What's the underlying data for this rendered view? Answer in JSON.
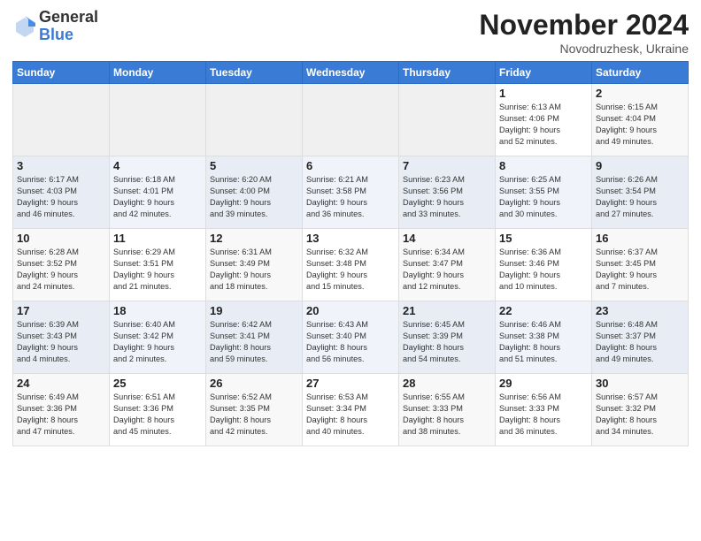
{
  "logo": {
    "general": "General",
    "blue": "Blue"
  },
  "title": "November 2024",
  "location": "Novodruzhesk, Ukraine",
  "days_of_week": [
    "Sunday",
    "Monday",
    "Tuesday",
    "Wednesday",
    "Thursday",
    "Friday",
    "Saturday"
  ],
  "weeks": [
    [
      {
        "day": "",
        "info": ""
      },
      {
        "day": "",
        "info": ""
      },
      {
        "day": "",
        "info": ""
      },
      {
        "day": "",
        "info": ""
      },
      {
        "day": "",
        "info": ""
      },
      {
        "day": "1",
        "info": "Sunrise: 6:13 AM\nSunset: 4:06 PM\nDaylight: 9 hours\nand 52 minutes."
      },
      {
        "day": "2",
        "info": "Sunrise: 6:15 AM\nSunset: 4:04 PM\nDaylight: 9 hours\nand 49 minutes."
      }
    ],
    [
      {
        "day": "3",
        "info": "Sunrise: 6:17 AM\nSunset: 4:03 PM\nDaylight: 9 hours\nand 46 minutes."
      },
      {
        "day": "4",
        "info": "Sunrise: 6:18 AM\nSunset: 4:01 PM\nDaylight: 9 hours\nand 42 minutes."
      },
      {
        "day": "5",
        "info": "Sunrise: 6:20 AM\nSunset: 4:00 PM\nDaylight: 9 hours\nand 39 minutes."
      },
      {
        "day": "6",
        "info": "Sunrise: 6:21 AM\nSunset: 3:58 PM\nDaylight: 9 hours\nand 36 minutes."
      },
      {
        "day": "7",
        "info": "Sunrise: 6:23 AM\nSunset: 3:56 PM\nDaylight: 9 hours\nand 33 minutes."
      },
      {
        "day": "8",
        "info": "Sunrise: 6:25 AM\nSunset: 3:55 PM\nDaylight: 9 hours\nand 30 minutes."
      },
      {
        "day": "9",
        "info": "Sunrise: 6:26 AM\nSunset: 3:54 PM\nDaylight: 9 hours\nand 27 minutes."
      }
    ],
    [
      {
        "day": "10",
        "info": "Sunrise: 6:28 AM\nSunset: 3:52 PM\nDaylight: 9 hours\nand 24 minutes."
      },
      {
        "day": "11",
        "info": "Sunrise: 6:29 AM\nSunset: 3:51 PM\nDaylight: 9 hours\nand 21 minutes."
      },
      {
        "day": "12",
        "info": "Sunrise: 6:31 AM\nSunset: 3:49 PM\nDaylight: 9 hours\nand 18 minutes."
      },
      {
        "day": "13",
        "info": "Sunrise: 6:32 AM\nSunset: 3:48 PM\nDaylight: 9 hours\nand 15 minutes."
      },
      {
        "day": "14",
        "info": "Sunrise: 6:34 AM\nSunset: 3:47 PM\nDaylight: 9 hours\nand 12 minutes."
      },
      {
        "day": "15",
        "info": "Sunrise: 6:36 AM\nSunset: 3:46 PM\nDaylight: 9 hours\nand 10 minutes."
      },
      {
        "day": "16",
        "info": "Sunrise: 6:37 AM\nSunset: 3:45 PM\nDaylight: 9 hours\nand 7 minutes."
      }
    ],
    [
      {
        "day": "17",
        "info": "Sunrise: 6:39 AM\nSunset: 3:43 PM\nDaylight: 9 hours\nand 4 minutes."
      },
      {
        "day": "18",
        "info": "Sunrise: 6:40 AM\nSunset: 3:42 PM\nDaylight: 9 hours\nand 2 minutes."
      },
      {
        "day": "19",
        "info": "Sunrise: 6:42 AM\nSunset: 3:41 PM\nDaylight: 8 hours\nand 59 minutes."
      },
      {
        "day": "20",
        "info": "Sunrise: 6:43 AM\nSunset: 3:40 PM\nDaylight: 8 hours\nand 56 minutes."
      },
      {
        "day": "21",
        "info": "Sunrise: 6:45 AM\nSunset: 3:39 PM\nDaylight: 8 hours\nand 54 minutes."
      },
      {
        "day": "22",
        "info": "Sunrise: 6:46 AM\nSunset: 3:38 PM\nDaylight: 8 hours\nand 51 minutes."
      },
      {
        "day": "23",
        "info": "Sunrise: 6:48 AM\nSunset: 3:37 PM\nDaylight: 8 hours\nand 49 minutes."
      }
    ],
    [
      {
        "day": "24",
        "info": "Sunrise: 6:49 AM\nSunset: 3:36 PM\nDaylight: 8 hours\nand 47 minutes."
      },
      {
        "day": "25",
        "info": "Sunrise: 6:51 AM\nSunset: 3:36 PM\nDaylight: 8 hours\nand 45 minutes."
      },
      {
        "day": "26",
        "info": "Sunrise: 6:52 AM\nSunset: 3:35 PM\nDaylight: 8 hours\nand 42 minutes."
      },
      {
        "day": "27",
        "info": "Sunrise: 6:53 AM\nSunset: 3:34 PM\nDaylight: 8 hours\nand 40 minutes."
      },
      {
        "day": "28",
        "info": "Sunrise: 6:55 AM\nSunset: 3:33 PM\nDaylight: 8 hours\nand 38 minutes."
      },
      {
        "day": "29",
        "info": "Sunrise: 6:56 AM\nSunset: 3:33 PM\nDaylight: 8 hours\nand 36 minutes."
      },
      {
        "day": "30",
        "info": "Sunrise: 6:57 AM\nSunset: 3:32 PM\nDaylight: 8 hours\nand 34 minutes."
      }
    ]
  ]
}
